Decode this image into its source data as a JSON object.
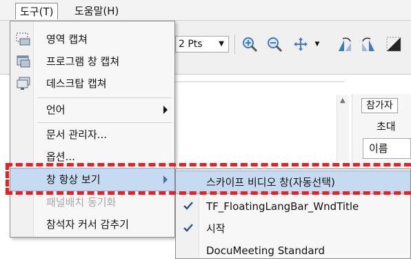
{
  "menubar": {
    "items": [
      {
        "label": "도구(T)"
      },
      {
        "label": "도움말(H)"
      }
    ]
  },
  "toolbar": {
    "pen_width": "2 Pts"
  },
  "right_panel": {
    "tab_label": "참가자",
    "invite_label": "초대",
    "name_field": "이름"
  },
  "tools_menu": {
    "items": [
      {
        "label": "영역 캡쳐",
        "icon": "area-capture-icon"
      },
      {
        "label": "프로그램 창 캡쳐",
        "icon": "window-capture-icon"
      },
      {
        "label": "데스크탑 캡쳐",
        "icon": "desktop-capture-icon"
      },
      {
        "label": "언어",
        "submenu": true
      },
      {
        "label": "문서 관리자..."
      },
      {
        "label": "옵션..."
      },
      {
        "label": "창 항상 보기",
        "submenu": true,
        "highlighted": true
      },
      {
        "label": "패널배치 동기화",
        "disabled": true
      },
      {
        "label": "참석자 커서 감추기"
      }
    ]
  },
  "always_on_top_submenu": {
    "items": [
      {
        "label": "스카이프 비디오 창(자동선택)",
        "highlighted": true,
        "checked": false
      },
      {
        "label": "TF_FloatingLangBar_WndTitle",
        "checked": true
      },
      {
        "label": "시작",
        "checked": true
      },
      {
        "label": "DocuMeeting Standard",
        "checked": false
      }
    ]
  },
  "colors": {
    "highlight": "#c6daf2",
    "annotation": "#e8201e",
    "toolbar_blue": "#3a78c8"
  }
}
